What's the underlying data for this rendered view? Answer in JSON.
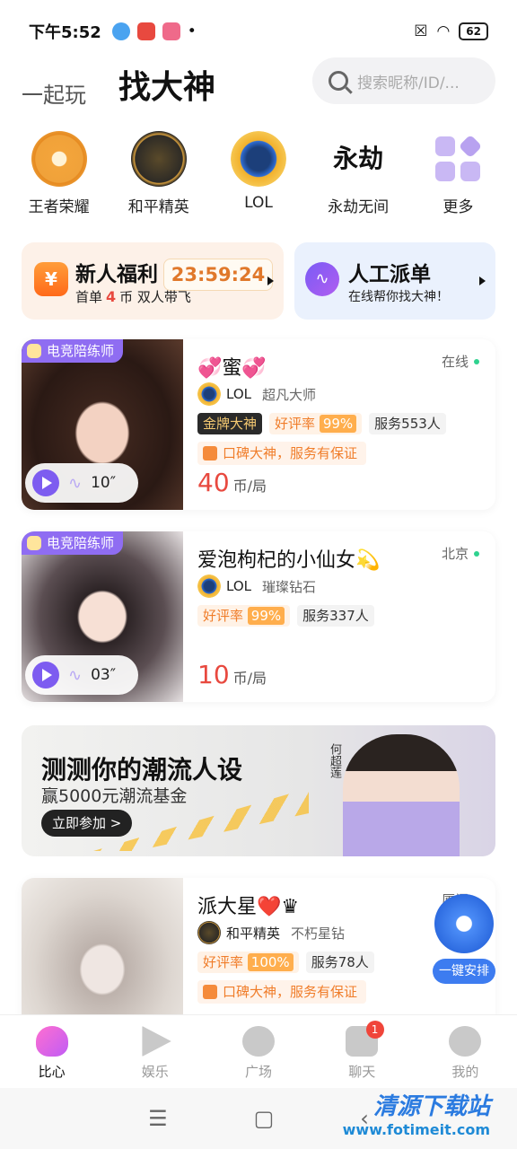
{
  "status": {
    "time": "下午5:52",
    "battery": "62"
  },
  "header": {
    "tab_play": "一起玩",
    "tab_find": "找大神",
    "search_placeholder": "搜索昵称/ID/..."
  },
  "games": [
    {
      "label": "王者荣耀",
      "icon": "honor-of-kings-icon"
    },
    {
      "label": "和平精英",
      "icon": "peace-elite-icon"
    },
    {
      "label": "LOL",
      "icon": "lol-icon"
    },
    {
      "label": "永劫无间",
      "icon": "naraka-icon",
      "glyph": "永劫"
    },
    {
      "label": "更多",
      "icon": "more-icon"
    }
  ],
  "promo": {
    "newbie": {
      "title": "新人福利",
      "timer": "23:59:24",
      "sub_a": "首单",
      "sub_num": "4",
      "sub_b": "币 双人带飞"
    },
    "dispatch": {
      "title": "人工派单",
      "sub": "在线帮你找大神！"
    }
  },
  "players": [
    {
      "badge": "电竞陪练师",
      "duration": "10″",
      "name": "💞蜜💞",
      "location": "在线",
      "game": "LOL",
      "rank": "超凡大师",
      "tag_gold": "金牌大神",
      "rate_label": "好评率",
      "rate": "99%",
      "service": "服务553人",
      "praise": "口碑大神，服务有保证",
      "price": "40",
      "unit": "币/局"
    },
    {
      "badge": "电竞陪练师",
      "duration": "03″",
      "name": "爱泡枸杞的小仙女💫",
      "location": "北京",
      "game": "LOL",
      "rank": "璀璨钻石",
      "rate_label": "好评率",
      "rate": "99%",
      "service": "服务337人",
      "price": "10",
      "unit": "币/局"
    },
    {
      "name": "派大星❤️♛",
      "location": "厦门",
      "game": "和平精英",
      "rank": "不朽星钻",
      "rate_label": "好评率",
      "rate": "100%",
      "service": "服务78人",
      "praise": "口碑大神，服务有保证"
    }
  ],
  "banner": {
    "title": "测测你的潮流人设",
    "sub": "赢5000元潮流基金",
    "button": "立即参加 >",
    "sign": "何超莲"
  },
  "float_button": "一键安排",
  "nav": [
    {
      "label": "比心"
    },
    {
      "label": "娱乐"
    },
    {
      "label": "广场"
    },
    {
      "label": "聊天",
      "badge": "1"
    },
    {
      "label": "我的"
    }
  ],
  "watermark": {
    "name": "清源下载站",
    "url": "www.fotimeit.com"
  }
}
